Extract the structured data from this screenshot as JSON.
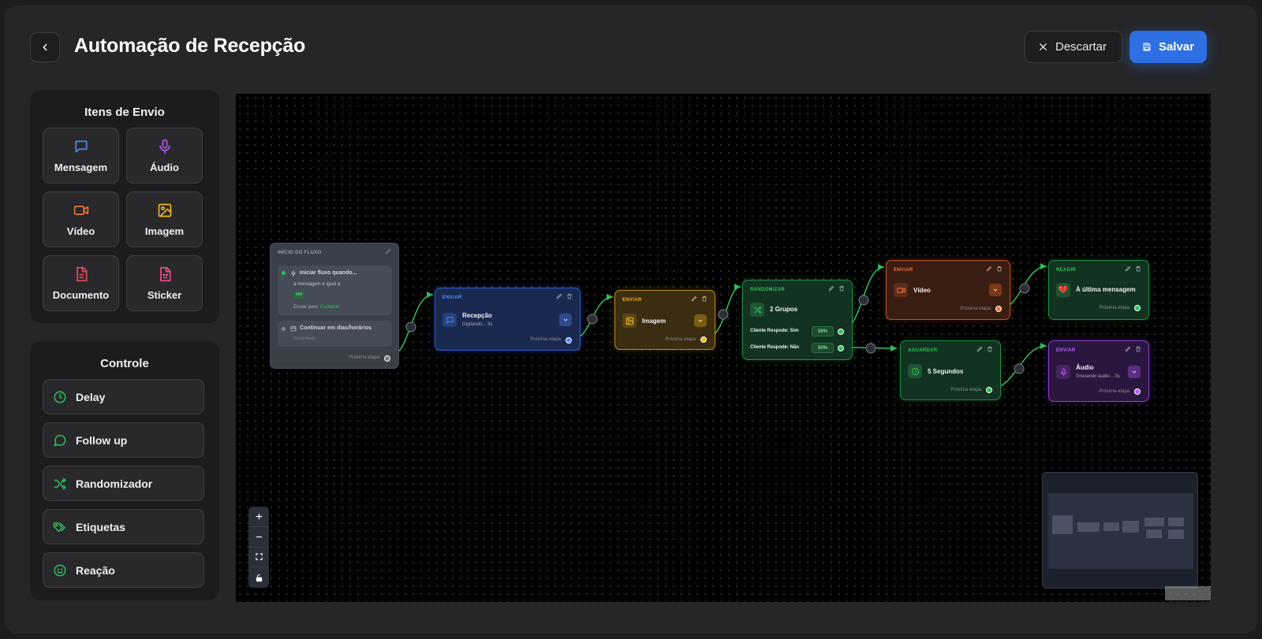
{
  "header": {
    "title": "Automação de Recepção",
    "discard_label": "Descartar",
    "save_label": "Salvar"
  },
  "send_items": {
    "title": "Itens de Envio",
    "items": [
      {
        "label": "Mensagem",
        "icon": "message-icon",
        "color": "#4f8ef7"
      },
      {
        "label": "Áudio",
        "icon": "mic-icon",
        "color": "#b45cf0"
      },
      {
        "label": "Vídeo",
        "icon": "video-icon",
        "color": "#f0733a"
      },
      {
        "label": "Imagem",
        "icon": "image-icon",
        "color": "#f2b721"
      },
      {
        "label": "Documento",
        "icon": "document-icon",
        "color": "#f2485a"
      },
      {
        "label": "Sticker",
        "icon": "sticker-icon",
        "color": "#f04f8e"
      }
    ]
  },
  "control": {
    "title": "Controle",
    "items": [
      {
        "label": "Delay",
        "icon": "clock-icon"
      },
      {
        "label": "Follow up",
        "icon": "chat-icon"
      },
      {
        "label": "Randomizador",
        "icon": "shuffle-icon"
      },
      {
        "label": "Etiquetas",
        "icon": "tags-icon"
      },
      {
        "label": "Reação",
        "icon": "smile-icon"
      }
    ],
    "color": "#2fc25b"
  },
  "flow": {
    "start": {
      "label": "INÍCIO DO FLUXO",
      "trigger_title": "Iniciar fluxo quando...",
      "trigger_condition": "a mensagem é igual a:",
      "trigger_value": "###",
      "send_to_prefix": "Enviar para:",
      "send_to_value": "Contatos",
      "schedule_title": "Continuar em dias/horários",
      "schedule_sub": "Desabilitado",
      "next_label": "Próxima etapa"
    },
    "send_message": {
      "label": "ENVIAR",
      "title": "Recepção",
      "sub": "Digitando... 3s",
      "next_label": "Próxima etapa"
    },
    "send_image": {
      "label": "ENVIAR",
      "title": "Imagem",
      "next_label": "Próxima etapa"
    },
    "randomizer": {
      "label": "RANDOMIZAR",
      "title": "2 Grupos",
      "group1": "Cliente Respode: Sim",
      "group1_pct": "50%",
      "group2": "Cliente Respode: Não",
      "group2_pct": "50%"
    },
    "send_video": {
      "label": "ENVIAR",
      "title": "Vídeo",
      "next_label": "Próxima etapa"
    },
    "wait": {
      "label": "AGUARDAR",
      "title": "5 Segundos",
      "next_label": "Próxima etapa"
    },
    "react": {
      "label": "REAGIR",
      "title": "À última mensagem",
      "emoji": "💔",
      "next_label": "Próxima etapa"
    },
    "send_audio": {
      "label": "ENVIAR",
      "title": "Áudio",
      "sub": "Gravando áudio... 3s",
      "next_label": "Próxima etapa"
    }
  },
  "canvas_controls": {
    "zoom_in": "zoom-in-icon",
    "zoom_out": "zoom-out-icon",
    "fit": "fit-view-icon",
    "lock": "lock-icon"
  },
  "attribution": "React Flow"
}
